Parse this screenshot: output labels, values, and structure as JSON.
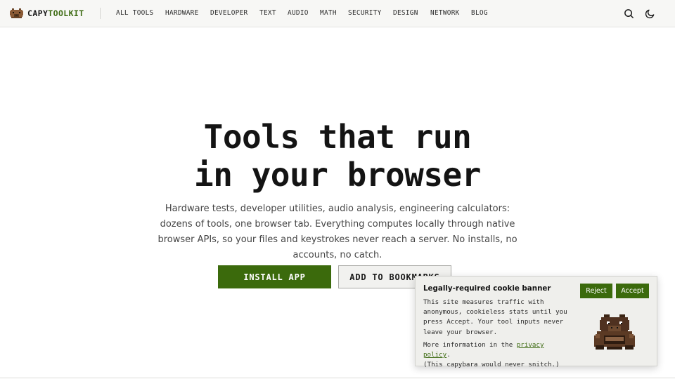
{
  "header": {
    "logo": {
      "part1": "CAPY",
      "part2": "TOOLKIT",
      "icon": "capybara-logo-icon"
    },
    "nav": [
      {
        "label": "ALL TOOLS"
      },
      {
        "label": "HARDWARE"
      },
      {
        "label": "DEVELOPER"
      },
      {
        "label": "TEXT"
      },
      {
        "label": "AUDIO"
      },
      {
        "label": "MATH"
      },
      {
        "label": "SECURITY"
      },
      {
        "label": "DESIGN"
      },
      {
        "label": "NETWORK"
      },
      {
        "label": "BLOG"
      }
    ],
    "actions": {
      "search_icon": "search-icon",
      "theme_icon": "moon-icon"
    }
  },
  "hero": {
    "title_line1": "Tools that run",
    "title_line2": "in your browser",
    "description": "Hardware tests, developer utilities, audio analysis, engineering calculators: dozens of tools, one browser tab. Everything computes locally through native browser APIs, so your files and keystrokes never reach a server. No installs, no accounts, no catch.",
    "install_label": "INSTALL APP",
    "bookmark_label": "ADD TO BOOKMARKS"
  },
  "cookie": {
    "title": "Legally-required cookie banner",
    "reject_label": "Reject",
    "accept_label": "Accept",
    "body": "This site measures traffic with anonymous, cookieless stats until you press Accept. Your tool inputs never leave your browser.",
    "more_prefix": "More information in the ",
    "link_text": "privacy policy",
    "more_suffix": ".",
    "aside": "(This capybara would never snitch.)",
    "image_icon": "capybara-pixel-icon"
  },
  "colors": {
    "accent": "#3b6a0c",
    "logo_accent": "#3d6b12",
    "header_bg": "#f7f7f5",
    "banner_bg": "#efefec"
  }
}
